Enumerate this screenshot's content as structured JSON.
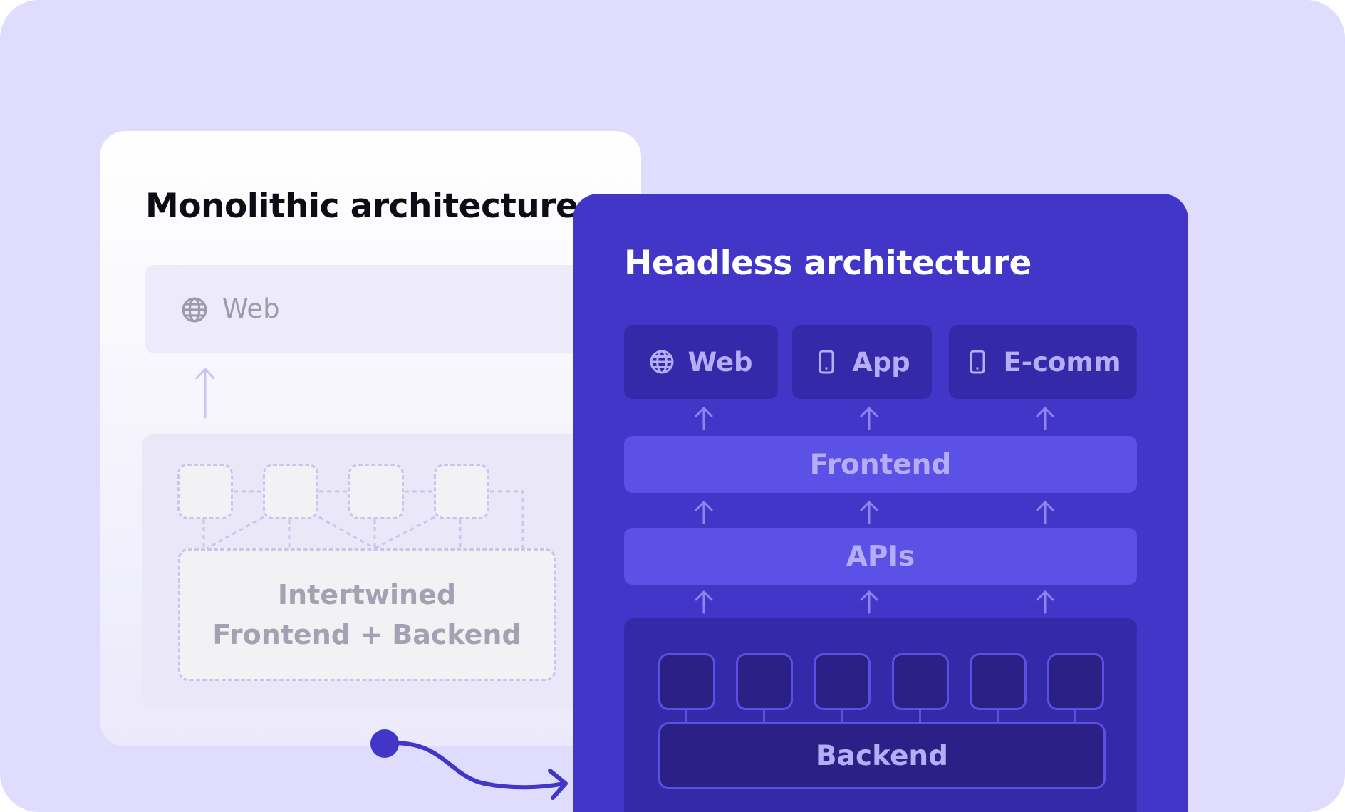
{
  "monolithic": {
    "title": "Monolithic architecture",
    "web_label": "Web",
    "core_line1": "Intertwined",
    "core_line2": "Frontend + Backend"
  },
  "headless": {
    "title": "Headless architecture",
    "channels": [
      {
        "label": "Web",
        "icon": "globe-icon"
      },
      {
        "label": "App",
        "icon": "phone-icon"
      },
      {
        "label": "E-comm",
        "icon": "phone-icon"
      }
    ],
    "frontend_label": "Frontend",
    "apis_label": "APIs",
    "backend_label": "Backend"
  },
  "colors": {
    "background": "#dfdcfd",
    "headless_card": "#4136c8",
    "headless_tile": "#3429a8",
    "headless_layer": "#5b51e6",
    "accent_text": "#b5aef7"
  }
}
